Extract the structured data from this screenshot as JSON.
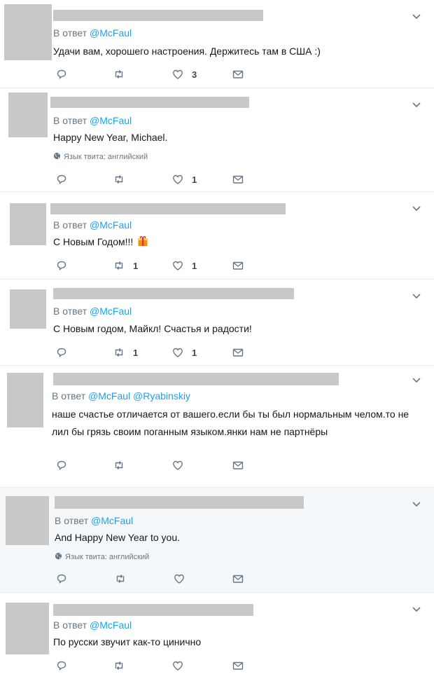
{
  "tweets": [
    {
      "reply_prefix": "В ответ",
      "mentions": [
        "@McFaul"
      ],
      "text": "Удачи вам, хорошего настроения. Держитесь там в США :)",
      "language_note": "",
      "counts": {
        "reply": "",
        "retweet": "",
        "like": "3"
      }
    },
    {
      "reply_prefix": "В ответ",
      "mentions": [
        "@McFaul"
      ],
      "text": "Happy New Year, Michael.",
      "language_note": "Язык твита: английский",
      "counts": {
        "reply": "",
        "retweet": "",
        "like": "1"
      }
    },
    {
      "reply_prefix": "В ответ",
      "mentions": [
        "@McFaul"
      ],
      "text": "С Новым Годом!!!",
      "language_note": "",
      "counts": {
        "reply": "",
        "retweet": "1",
        "like": "1"
      }
    },
    {
      "reply_prefix": "В ответ",
      "mentions": [
        "@McFaul"
      ],
      "text": "С Новым годом, Майкл! Счастья и радости!",
      "language_note": "",
      "counts": {
        "reply": "",
        "retweet": "1",
        "like": "1"
      }
    },
    {
      "reply_prefix": "В ответ",
      "mentions": [
        "@McFaul",
        "@Ryabinskiy"
      ],
      "text": "наше счастье отличается от вашего.если бы ты был нормальным челом.то не лил бы грязь своим поганным языком.янки нам не партнёры",
      "language_note": "",
      "counts": {
        "reply": "",
        "retweet": "",
        "like": ""
      }
    },
    {
      "reply_prefix": "В ответ",
      "mentions": [
        "@McFaul"
      ],
      "text": "And Happy New Year to you.",
      "language_note": "Язык твита: английский",
      "counts": {
        "reply": "",
        "retweet": "",
        "like": ""
      }
    },
    {
      "reply_prefix": "В ответ",
      "mentions": [
        "@McFaul"
      ],
      "text": "По русски звучит как-то цинично",
      "language_note": "",
      "counts": {
        "reply": "",
        "retweet": "",
        "like": ""
      }
    }
  ],
  "colors": {
    "accent": "#1da1f2",
    "muted": "#657786",
    "text": "#14171a",
    "highlight_bg": "#f5f8fa"
  },
  "icons": [
    "reply-icon",
    "retweet-icon",
    "like-icon",
    "dm-icon",
    "caret-down-icon",
    "globe-icon",
    "gift-emoji"
  ]
}
